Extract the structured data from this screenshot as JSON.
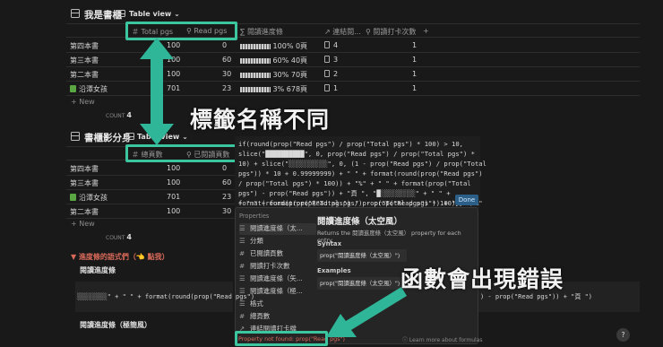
{
  "table1": {
    "title": "我是書櫃",
    "view": "Table view",
    "headers": [
      "Total pgs",
      "Read pgs",
      "閱讀進度條",
      "連結閱...",
      "閱讀打卡次數"
    ],
    "rows": [
      {
        "name": "第四本書",
        "total": "100",
        "read": "0",
        "progress": "100% 0頁",
        "links": "4",
        "checkins": "1"
      },
      {
        "name": "第三本書",
        "total": "100",
        "read": "60",
        "progress": "60% 40頁",
        "links": "3",
        "checkins": "1"
      },
      {
        "name": "第二本書",
        "total": "100",
        "read": "30",
        "progress": "30% 70頁",
        "links": "2",
        "checkins": "1"
      },
      {
        "name": "沿潭女孩",
        "total": "701",
        "read": "23",
        "progress": "3% 678頁",
        "links": "1",
        "checkins": "1"
      }
    ],
    "new_label": "New",
    "count_label": "COUNT",
    "count_value": "4"
  },
  "table2": {
    "title": "書櫃影分身",
    "view": "Table view",
    "headers": [
      "總頁數",
      "已閱讀頁數"
    ],
    "rows": [
      {
        "name": "第四本書",
        "total": "100",
        "read": "0"
      },
      {
        "name": "第三本書",
        "total": "100",
        "read": "60"
      },
      {
        "name": "沿潭女孩",
        "total": "701",
        "read": "23"
      },
      {
        "name": "第二本書",
        "total": "100",
        "read": "30"
      }
    ],
    "new_label": "New",
    "count_label": "COUNT",
    "count_value": "4"
  },
  "formula_code": [
    "if(round(prop(\"Read pgs\") / prop(\"Total pgs\") * 100) > 10,",
    "slice(\"██████████\", 0, prop(\"Read pgs\") / prop(\"Total pgs\") *",
    "10) + slice(\"░░░░░░░░░░\", 0, (1 - prop(\"Read pgs\") / prop(\"Total",
    "pgs\")) * 10 + 0.99999999) + \" \" + format(round(prop(\"Read pgs\")",
    "/ prop(\"Total pgs\") * 100)) + \"%\" + \" \" + format(prop(\"Total",
    "pgs\") - prop(\"Read pgs\")) + \"頁 \", \"█░░░░░░░░░\" + \" \" +",
    "format(round(prop(\"Read pgs\") / prop(\"Total pgs\") * 100)) + \"%\"",
    "+ \" \" + format(prop(\"Total pgs\") - prop(\"Read pgs\")) + \"頁 \")"
  ],
  "done_label": "Done",
  "properties_panel": {
    "heading": "Properties",
    "items": [
      "閱讀進度條（太...",
      "分類",
      "已閱讀頁數",
      "閱讀打卡次數",
      "閱讀進度條（矢...",
      "閱讀進度條（極...",
      "格式",
      "總頁數",
      "連結閱讀打卡檔"
    ],
    "item_icons": [
      "☰",
      "☰",
      "#",
      "#",
      "☰",
      "☰",
      "☰",
      "#",
      "↗"
    ],
    "detail_title": "閱讀進度條（太空風）",
    "detail_desc": "Returns the 閱讀進度條（太空風） property for each entry.",
    "syntax_label": "Syntax",
    "syntax_code": "prop(\"閱讀進度條（太空風）\")",
    "examples_label": "Examples",
    "examples_code": "prop(\"閱讀進度條（太空風）\")",
    "error_text": "Property not found: prop(\"Read pgs\")",
    "learn_more": "Learn more about formulas"
  },
  "section": {
    "toggle_title": "進度條的語式們（👈 點我）",
    "sub1": "閱讀進度條",
    "code_line_left": "░░░░░░░░\" + \" \" + format(round(prop(\"Read pgs\")",
    "code_line_right": ") - prop(\"Read pgs\")) + \"頁 \")",
    "sub2": "閱讀進度條（極簡風）"
  },
  "annotations": {
    "top": "標籤名稱不同",
    "bottom": "函數會出現錯誤"
  },
  "help_label": "?",
  "colors": {
    "accent_green": "#3cc6a0",
    "background": "#191919",
    "arrow_teal": "#2fb597"
  }
}
